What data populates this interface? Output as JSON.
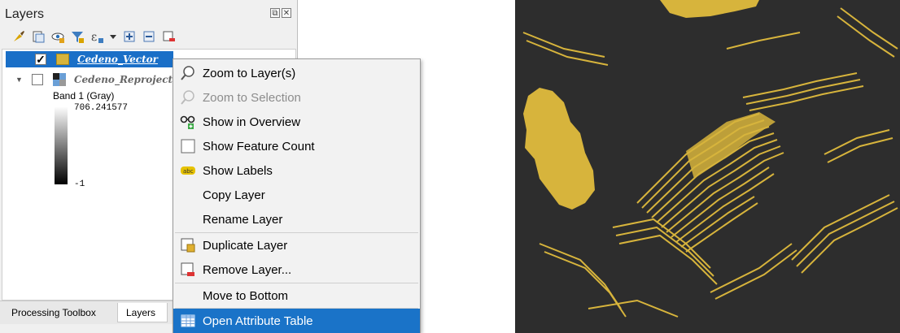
{
  "panel": {
    "title": "Layers",
    "float_glyph": "⧉",
    "close_glyph": "✕",
    "toolbar_icons": [
      "style-brush-icon",
      "add-group-icon",
      "visibility-eye-icon",
      "filter-icon",
      "expression-filter-icon",
      "dropdown-arrow-icon",
      "expand-all-icon",
      "collapse-all-icon",
      "remove-layer-icon"
    ]
  },
  "tree": {
    "vector_layer": {
      "label": "Cedeno_Vector",
      "checked": true,
      "check_glyph": "✓",
      "swatch_color": "#d7b43c"
    },
    "raster_layer": {
      "label": "Cedeno_Reproject",
      "expand_glyph": "▼",
      "checked": false
    },
    "band_label": "Band 1 (Gray)",
    "max_value": "706.241577",
    "min_value": "-1"
  },
  "tabs": {
    "processing": "Processing Toolbox",
    "layers": "Layers"
  },
  "colors": {
    "selection": "#1a73c8",
    "feature_fill": "#d7b43c",
    "map_background": "#2d2d2d"
  },
  "context_menu": {
    "items": [
      {
        "label": "Zoom to Layer(s)",
        "icon": "zoom-icon",
        "enabled": true
      },
      {
        "label": "Zoom to Selection",
        "icon": "zoom-selection-icon",
        "enabled": false
      },
      {
        "label": "Show in Overview",
        "icon": "overview-glasses-icon",
        "enabled": true
      },
      {
        "label": "Show Feature Count",
        "icon": "checkbox-icon",
        "enabled": true
      },
      {
        "label": "Show Labels",
        "icon": "labels-abc-icon",
        "enabled": true
      },
      {
        "label": "Copy Layer",
        "icon": "",
        "enabled": true
      },
      {
        "label": "Rename Layer",
        "icon": "",
        "enabled": true
      },
      {
        "label": "Duplicate Layer",
        "icon": "duplicate-layer-icon",
        "enabled": true
      },
      {
        "label": "Remove Layer...",
        "icon": "remove-layer-icon",
        "enabled": true
      },
      {
        "label": "Move to Bottom",
        "icon": "",
        "enabled": true
      },
      {
        "label": "Open Attribute Table",
        "icon": "table-icon",
        "enabled": true,
        "highlighted": true
      }
    ]
  }
}
